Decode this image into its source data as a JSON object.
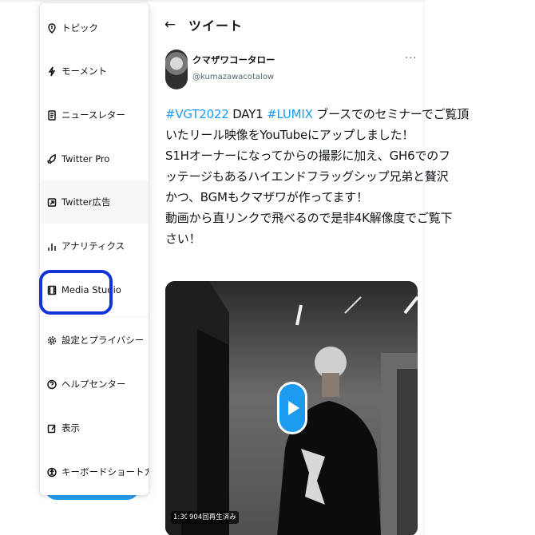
{
  "menu": {
    "items": [
      {
        "label": "トピック",
        "icon": "topics-icon"
      },
      {
        "label": "モーメント",
        "icon": "moments-icon"
      },
      {
        "label": "ニュースレター",
        "icon": "newsletter-icon"
      },
      {
        "label": "Twitter Pro",
        "icon": "rocket-icon"
      },
      {
        "label": "Twitter広告",
        "icon": "ads-icon"
      },
      {
        "label": "アナリティクス",
        "icon": "analytics-icon"
      },
      {
        "label": "Media Studio",
        "icon": "media-studio-icon"
      },
      {
        "label": "設定とプライバシー",
        "icon": "settings-icon"
      },
      {
        "label": "ヘルプセンター",
        "icon": "help-icon"
      },
      {
        "label": "表示",
        "icon": "display-icon"
      },
      {
        "label": "キーボードショートカット",
        "icon": "accessibility-icon"
      }
    ]
  },
  "header": {
    "back_icon": "←",
    "title": "ツイート"
  },
  "tweet": {
    "author_name": "クマザワコータロー",
    "author_handle": "@kumazawacotalow",
    "more_label": "···",
    "line1_tag1": "#VGT2022",
    "line1_text1": " DAY1 ",
    "line1_tag2": "#LUMIX",
    "line1_text2": " ブースでのセミナーでご覧頂",
    "line2": "いたリール映像をYouTubeにアップしました！",
    "line3": "S1Hオーナーになってからの撮影に加え、GH6でのフ",
    "line4": "ッテージもあるハイエンドフラッグシップ兄弟と贅沢",
    "line5": "かつ、BGMもクマザワが作ってます！",
    "line6": "動画から直リンクで飛べるので是非4K解像度でご覧下",
    "line7": "さい！",
    "video_duration": "1:30",
    "video_views": "904回再生済み"
  },
  "colors": {
    "accent": "#1d9bf0",
    "highlight_ring": "#1034d8",
    "text": "#0f1419",
    "muted": "#536471"
  }
}
